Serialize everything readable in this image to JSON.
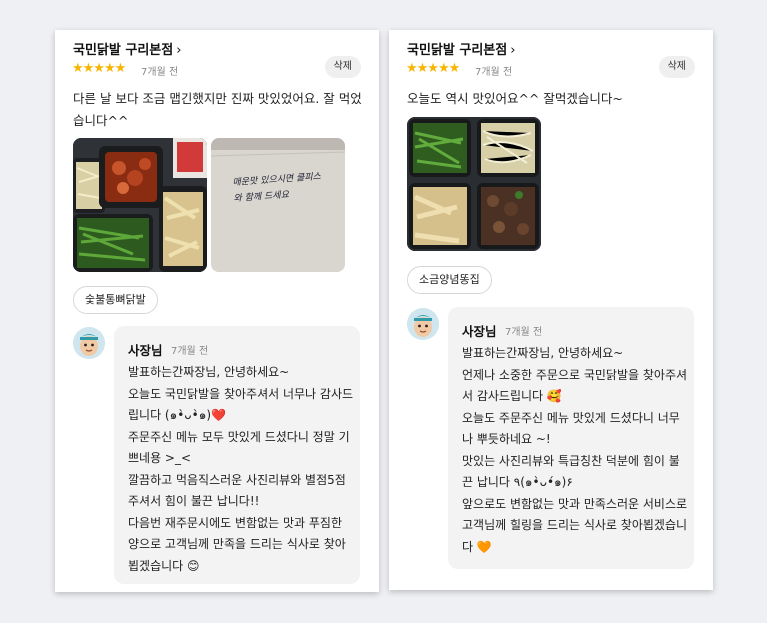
{
  "reviews": [
    {
      "store": "국민닭발 구리본점",
      "chevron": "›",
      "stars": "★★★★★",
      "date": "7개월 전",
      "delete_label": "삭제",
      "text": "다른 날 보다 조금 맵긴했지만 진짜 맛있었어요. 잘 먹었습니다^^",
      "note_text": "매운맛 있으시면 쿨피스와 함께 드세요",
      "menu_tag": "숯불통뼈닭발",
      "owner_name": "사장님",
      "owner_date": "7개월 전",
      "owner_reply": "발표하는간짜장님, 안녕하세요~\n오늘도 국민닭발을 찾아주셔서 너무나 감사드립니다 (๑•̀ᴗ•̀๑)❤️\n주문주신 메뉴 모두 맛있게 드셨다니 정말 기쁘네용 >_<\n깔끔하고 먹음직스러운 사진리뷰와 별점5점 주셔서 힘이 불끈 납니다!!\n다음번 재주문시에도 변함없는 맛과 푸짐한 양으로 고객님께 만족을 드리는 식사로 찾아뵙겠습니다 😊"
    },
    {
      "store": "국민닭발 구리본점",
      "chevron": "›",
      "stars": "★★★★★",
      "date": "7개월 전",
      "delete_label": "삭제",
      "text": "오늘도 역시 맛있어요^^ 잘먹겠습니다~",
      "menu_tag": "소금양념똥집",
      "owner_name": "사장님",
      "owner_date": "7개월 전",
      "owner_reply": "발표하는간짜장님, 안녕하세요~\n언제나 소중한 주문으로 국민닭발을 찾아주셔서 감사드립니다 🥰\n오늘도 주문주신 메뉴 맛있게 드셨다니 너무나 뿌듯하네요 ~!\n맛있는 사진리뷰와 특급칭찬 덕분에 힘이 불끈 납니다 ٩(๑•̀ᴗ•́๑)۶\n앞으로도 변함없는 맛과 만족스러운 서비스로 고객님께 힐링을 드리는 식사로 찾아뵙겠습니다 🧡"
    }
  ],
  "colors": {
    "star": "#f7b500",
    "bubble": "#f3f3f3",
    "tag_border": "#d7d7d7"
  },
  "icons": [
    "chevron-right-icon",
    "star-icon",
    "owner-avatar-icon"
  ]
}
